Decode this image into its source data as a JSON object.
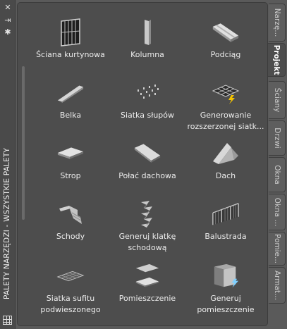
{
  "palette": {
    "title": "PALETY NARZĘDZI - WSZYSTKIE PALETY",
    "titlebar_buttons": [
      "close-icon",
      "autohide-icon",
      "properties-icon"
    ]
  },
  "tools": [
    {
      "label": "Ściana kurtynowa",
      "icon": "curtain-wall-icon"
    },
    {
      "label": "Kolumna",
      "icon": "column-icon"
    },
    {
      "label": "Podciąg",
      "icon": "beam-girder-icon"
    },
    {
      "label": "Belka",
      "icon": "beam-icon"
    },
    {
      "label": "Siatka słupów",
      "icon": "column-grid-icon"
    },
    {
      "label": "Generowanie\nrozszerzonej  siatk...",
      "icon": "enhanced-grid-icon"
    },
    {
      "label": "Strop",
      "icon": "slab-icon"
    },
    {
      "label": "Połać dachowa",
      "icon": "roof-slab-icon"
    },
    {
      "label": "Dach",
      "icon": "roof-icon"
    },
    {
      "label": "Schody",
      "icon": "stair-icon"
    },
    {
      "label": "Generuj klatkę\nschodową",
      "icon": "stair-tower-icon"
    },
    {
      "label": "Balustrada",
      "icon": "railing-icon"
    },
    {
      "label": "Siatka sufitu\npodwieszonego",
      "icon": "ceiling-grid-icon"
    },
    {
      "label": "Pomieszczenie",
      "icon": "space-icon"
    },
    {
      "label": "Generuj\npomieszczenie",
      "icon": "generate-space-icon"
    }
  ],
  "tabs": [
    {
      "label": "Narzę...",
      "active": false
    },
    {
      "label": "Projekt",
      "active": true
    },
    {
      "label": "Ściany",
      "active": false
    },
    {
      "label": "Drzwi",
      "active": false
    },
    {
      "label": "Okna",
      "active": false
    },
    {
      "label": "Okna ...",
      "active": false
    },
    {
      "label": "Pomie...",
      "active": false
    },
    {
      "label": "Armat...",
      "active": false
    }
  ],
  "colors": {
    "background": "#5a5a5a",
    "panel": "#4d4d4d",
    "text": "#ececec",
    "accent": "#f2c200"
  }
}
